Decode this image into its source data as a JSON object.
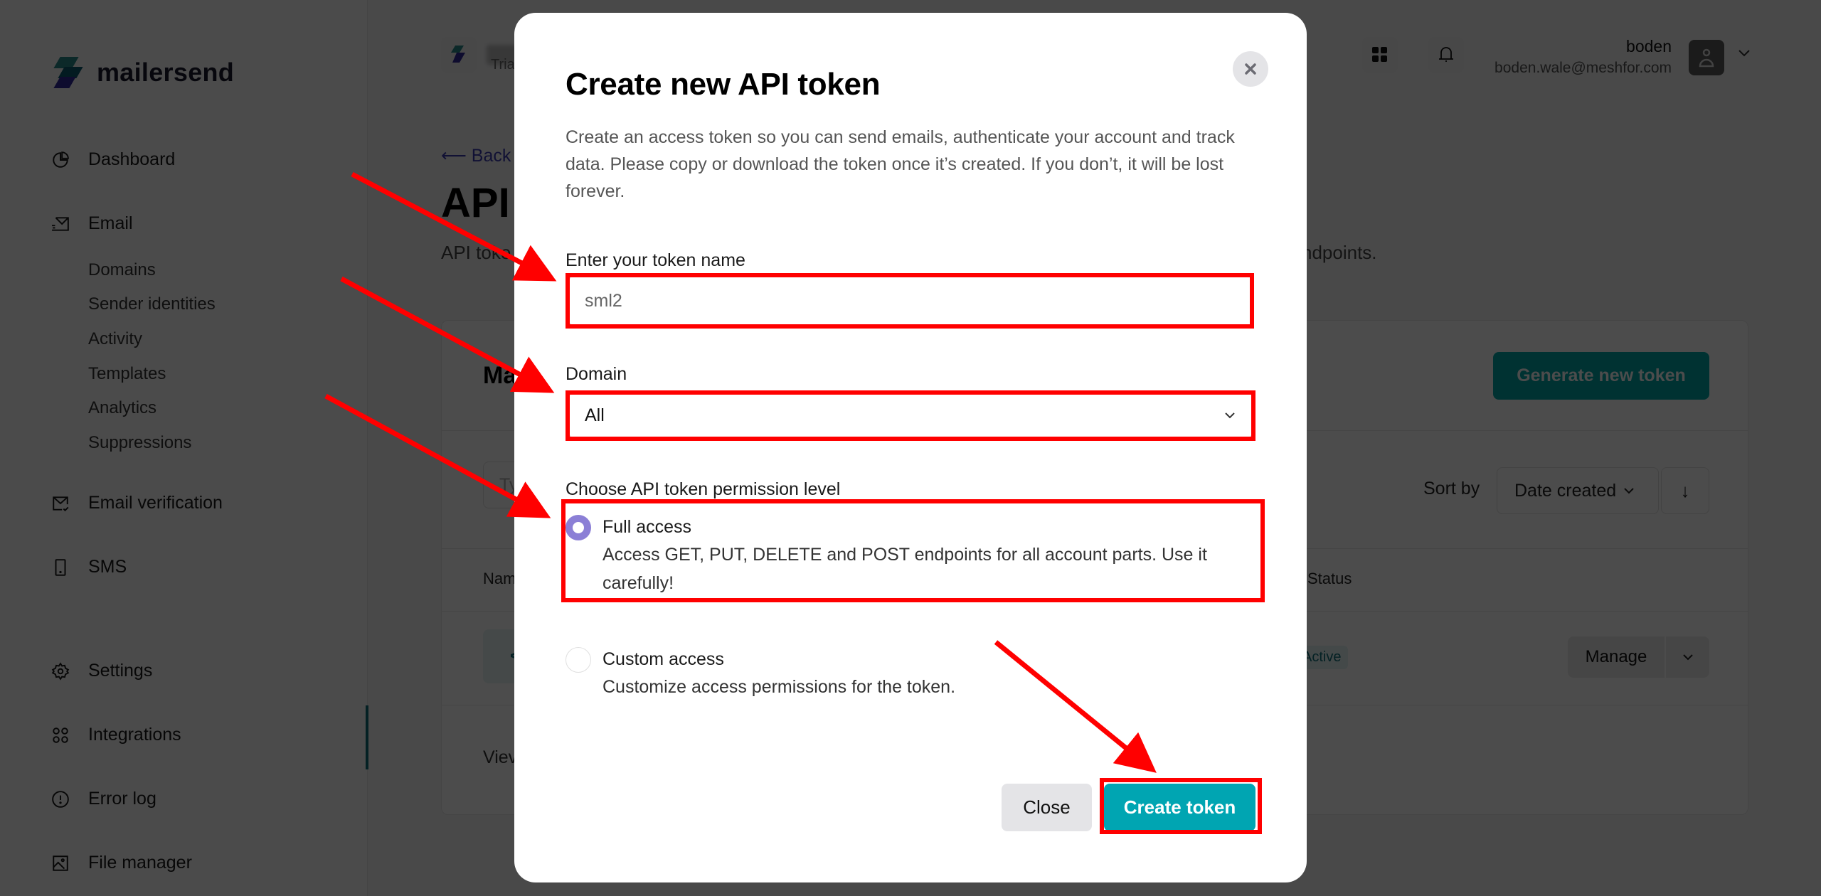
{
  "app": {
    "brand": "mailersend",
    "accent_color": "#00a5b2",
    "annotation_color": "#ff0000"
  },
  "sidebar": {
    "items": [
      {
        "label": "Dashboard",
        "icon": "pie-chart-icon"
      },
      {
        "label": "Email",
        "icon": "email-send-icon"
      },
      {
        "label": "Email verification",
        "icon": "email-check-icon"
      },
      {
        "label": "SMS",
        "icon": "phone-icon"
      },
      {
        "label": "Settings",
        "icon": "gear-icon"
      },
      {
        "label": "Integrations",
        "icon": "integrations-icon",
        "active": true
      },
      {
        "label": "Error log",
        "icon": "alert-circle-icon"
      },
      {
        "label": "File manager",
        "icon": "image-icon"
      }
    ],
    "email_subitems": [
      "Domains",
      "Sender identities",
      "Activity",
      "Templates",
      "Analytics",
      "Suppressions"
    ]
  },
  "header": {
    "account_plan": "Tria",
    "user_name": "boden",
    "user_email": "boden.wale@meshfor.com"
  },
  "page": {
    "back_label": "⟵ Back",
    "title": "API",
    "subtitle": "API toke",
    "subtitle_tail": "ndpoints.",
    "card": {
      "title": "Ma",
      "generate_button": "Generate new token",
      "search_placeholder": "Ty",
      "sort_label": "Sort by",
      "sort_value": "Date created",
      "columns": [
        "Nam",
        "Status"
      ],
      "row": {
        "name_chip": "<",
        "status": "Active",
        "manage_label": "Manage"
      },
      "view_all": "Viev"
    }
  },
  "modal": {
    "title": "Create new API token",
    "description": "Create an access token so you can send emails, authenticate your account and track data. Please copy or download the token once it’s created. If you don’t, it will be lost forever.",
    "token_name_label": "Enter your token name",
    "token_name_value": "sml2",
    "domain_label": "Domain",
    "domain_value": "All",
    "permission_label": "Choose API token permission level",
    "permissions": [
      {
        "title": "Full access",
        "description": "Access GET, PUT, DELETE and POST endpoints for all account parts. Use it carefully!",
        "selected": true
      },
      {
        "title": "Custom access",
        "description": "Customize access permissions for the token.",
        "selected": false
      }
    ],
    "close_label": "Close",
    "create_label": "Create token"
  }
}
